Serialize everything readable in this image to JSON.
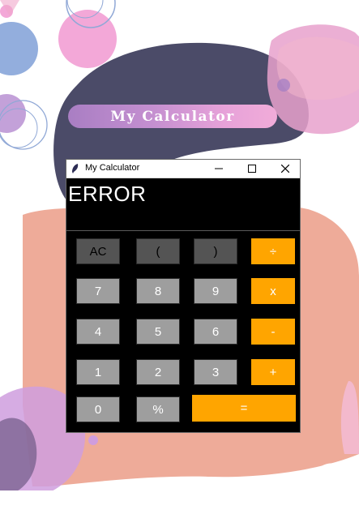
{
  "banner": {
    "title": "My Calculator"
  },
  "window": {
    "title": "My Calculator",
    "icon": "feather-icon",
    "controls": [
      "minimize-icon",
      "maximize-icon",
      "close-icon"
    ]
  },
  "display": {
    "value": "ERROR"
  },
  "keys": {
    "ac": "AC",
    "lparen": "(",
    "rparen": ")",
    "divide": "÷",
    "seven": "7",
    "eight": "8",
    "nine": "9",
    "multiply": "x",
    "four": "4",
    "five": "5",
    "six": "6",
    "minus": "-",
    "one": "1",
    "two": "2",
    "three": "3",
    "plus": "+",
    "zero": "0",
    "percent": "%",
    "equals": "="
  },
  "colors": {
    "operator": "#ffa500",
    "function_key": "#545454",
    "digit_key": "#9e9e9e",
    "display_bg": "#000000",
    "banner_start": "#a97ec3",
    "banner_end": "#f1acd9"
  }
}
